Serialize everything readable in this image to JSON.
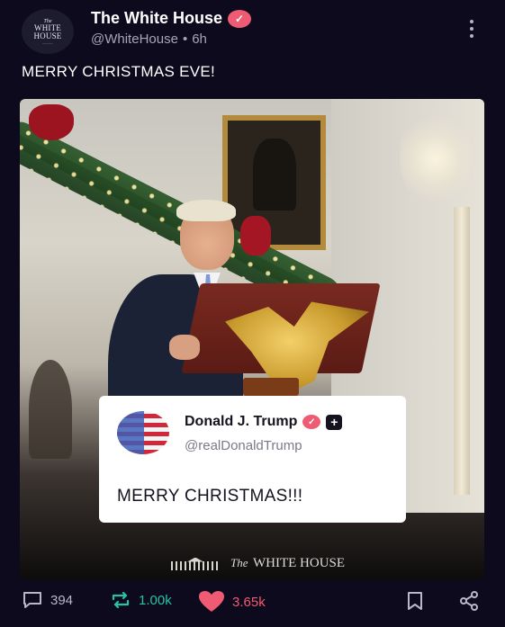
{
  "account": {
    "display_name": "The White House",
    "handle": "@WhiteHouse",
    "separator": "•",
    "time": "6h",
    "avatar_the": "The",
    "avatar_line1": "WHITE",
    "avatar_line2": "HOUSE"
  },
  "post": {
    "text": "MERRY CHRISTMAS EVE!"
  },
  "embedded_post": {
    "display_name": "Donald J. Trump",
    "handle": "@realDonaldTrump",
    "text": "MERRY CHRISTMAS!!!",
    "verified_glyph": "✓",
    "plus_glyph": "+"
  },
  "watermark": {
    "prefix": "The",
    "text": "WHITE HOUSE"
  },
  "actions": {
    "replies": "394",
    "reposts": "1.00k",
    "likes": "3.65k"
  },
  "colors": {
    "background": "#0c0a1c",
    "verified": "#ef5b73",
    "repost": "#27c3a3",
    "like": "#ef5b73",
    "muted": "#a7a5b6"
  },
  "icons": [
    "verified-badge-icon",
    "more-options-icon",
    "reply-icon",
    "repost-icon",
    "like-heart-icon",
    "bookmark-icon",
    "share-icon",
    "plus-icon"
  ]
}
